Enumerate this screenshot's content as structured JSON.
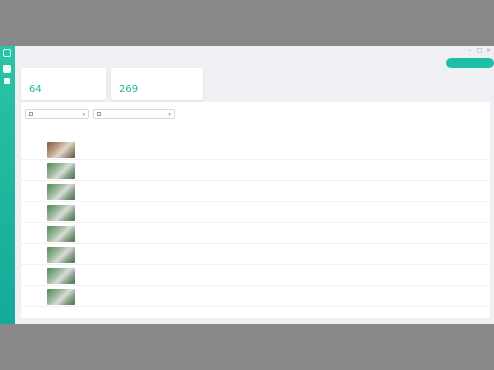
{
  "page": {
    "title": "",
    "add_button_label": ""
  },
  "stats": [
    {
      "label": "",
      "value": "64"
    },
    {
      "label": "",
      "value": "269"
    }
  ],
  "filters": {
    "type_select": "",
    "date_select": ""
  },
  "table": {
    "columns": [
      "",
      "",
      "",
      "",
      "",
      ""
    ],
    "rows": [
      {
        "name": "",
        "time": "",
        "type": "",
        "extra": "",
        "action": ""
      },
      {
        "name": "",
        "time": "",
        "type": "",
        "extra": "",
        "action": ""
      },
      {
        "name": "",
        "time": "",
        "type": "",
        "extra": "",
        "action": ""
      },
      {
        "name": "",
        "time": "",
        "type": "",
        "extra": "",
        "action": ""
      },
      {
        "name": "",
        "time": "",
        "type": "",
        "extra": "",
        "action": ""
      },
      {
        "name": "",
        "time": "",
        "type": "",
        "extra": "",
        "action": ""
      },
      {
        "name": "",
        "time": "",
        "type": "",
        "extra": "",
        "action": ""
      },
      {
        "name": "",
        "time": "",
        "type": "",
        "extra": "",
        "action": ""
      }
    ]
  },
  "pagination": {
    "first_icon": "first-page-icon",
    "prev_icon": "prev-page-icon",
    "current_page": "",
    "page_total_text": "",
    "next_icon": "next-page-icon",
    "last_icon": "last-page-icon"
  },
  "icons": {
    "sidebar_logo": "app-logo-icon",
    "sidebar_item_1": "user-icon",
    "sidebar_item_2": "document-icon",
    "filter_type": "filter-icon",
    "filter_date": "calendar-icon"
  },
  "colors": {
    "accent": "#1fbfa6",
    "sidebar_top": "#2bc4a4",
    "sidebar_bottom": "#14a99a",
    "link": "#3a6fe0"
  }
}
